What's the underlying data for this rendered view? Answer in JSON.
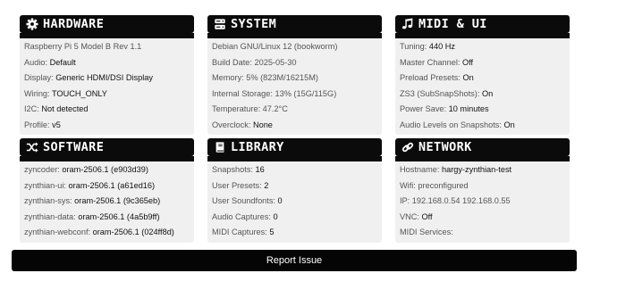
{
  "panels": {
    "hardware": {
      "title": "HARDWARE",
      "icon": "gear-icon",
      "rows": [
        {
          "label": "Raspberry Pi 5 Model B Rev 1.1",
          "value": ""
        },
        {
          "label": "Audio: ",
          "value": "Default"
        },
        {
          "label": "Display: ",
          "value": "Generic HDMI/DSI Display"
        },
        {
          "label": "Wiring: ",
          "value": "TOUCH_ONLY"
        },
        {
          "label": "I2C: ",
          "value": "Not detected"
        },
        {
          "label": "Profile: ",
          "value": "v5"
        }
      ]
    },
    "system": {
      "title": "SYSTEM",
      "icon": "server-icon",
      "rows": [
        {
          "label": "Debian GNU/Linux 12 (bookworm)",
          "value": ""
        },
        {
          "label": "Build Date: 2025-05-30",
          "value": ""
        },
        {
          "label": "Memory: 5% (823M/16215M)",
          "value": ""
        },
        {
          "label": "Internal Storage: 13% (15G/115G)",
          "value": ""
        },
        {
          "label": "Temperature: 47.2°C",
          "value": ""
        },
        {
          "label": "Overclock: ",
          "value": "None"
        }
      ]
    },
    "midi": {
      "title": "MIDI & UI",
      "icon": "music-note-icon",
      "rows": [
        {
          "label": "Tuning: ",
          "value": "440 Hz"
        },
        {
          "label": "Master Channel: ",
          "value": "Off"
        },
        {
          "label": "Preload Presets: ",
          "value": "On"
        },
        {
          "label": "ZS3 (SubSnapShots): ",
          "value": "On"
        },
        {
          "label": "Power Save: ",
          "value": "10 minutes"
        },
        {
          "label": "Audio Levels on Snapshots: ",
          "value": "On"
        }
      ]
    },
    "software": {
      "title": "SOFTWARE",
      "icon": "shuffle-icon",
      "rows": [
        {
          "label": "zyncoder: ",
          "value": "oram-2506.1 (e903d39)"
        },
        {
          "label": "zynthian-ui: ",
          "value": "oram-2506.1 (a61ed16)"
        },
        {
          "label": "zynthian-sys: ",
          "value": "oram-2506.1 (9c365eb)"
        },
        {
          "label": "zynthian-data: ",
          "value": "oram-2506.1 (4a5b9ff)"
        },
        {
          "label": "zynthian-webconf: ",
          "value": "oram-2506.1 (024ff8d)"
        }
      ]
    },
    "library": {
      "title": "LIBRARY",
      "icon": "book-icon",
      "rows": [
        {
          "label": "Snapshots: ",
          "value": "16"
        },
        {
          "label": "User Presets: ",
          "value": "2"
        },
        {
          "label": "User Soundfonts: ",
          "value": "0"
        },
        {
          "label": "Audio Captures: ",
          "value": "0"
        },
        {
          "label": "MIDI Captures: ",
          "value": "5"
        }
      ]
    },
    "network": {
      "title": "NETWORK",
      "icon": "link-icon",
      "rows": [
        {
          "label": "Hostname: ",
          "value": "hargy-zynthian-test"
        },
        {
          "label": "Wifi: preconfigured",
          "value": ""
        },
        {
          "label": "IP: 192.168.0.54 192.168.0.55",
          "value": ""
        },
        {
          "label": "VNC: ",
          "value": "Off"
        },
        {
          "label": "MIDI Services: ",
          "value": ""
        }
      ]
    }
  },
  "report_button": {
    "label": "Report Issue"
  }
}
